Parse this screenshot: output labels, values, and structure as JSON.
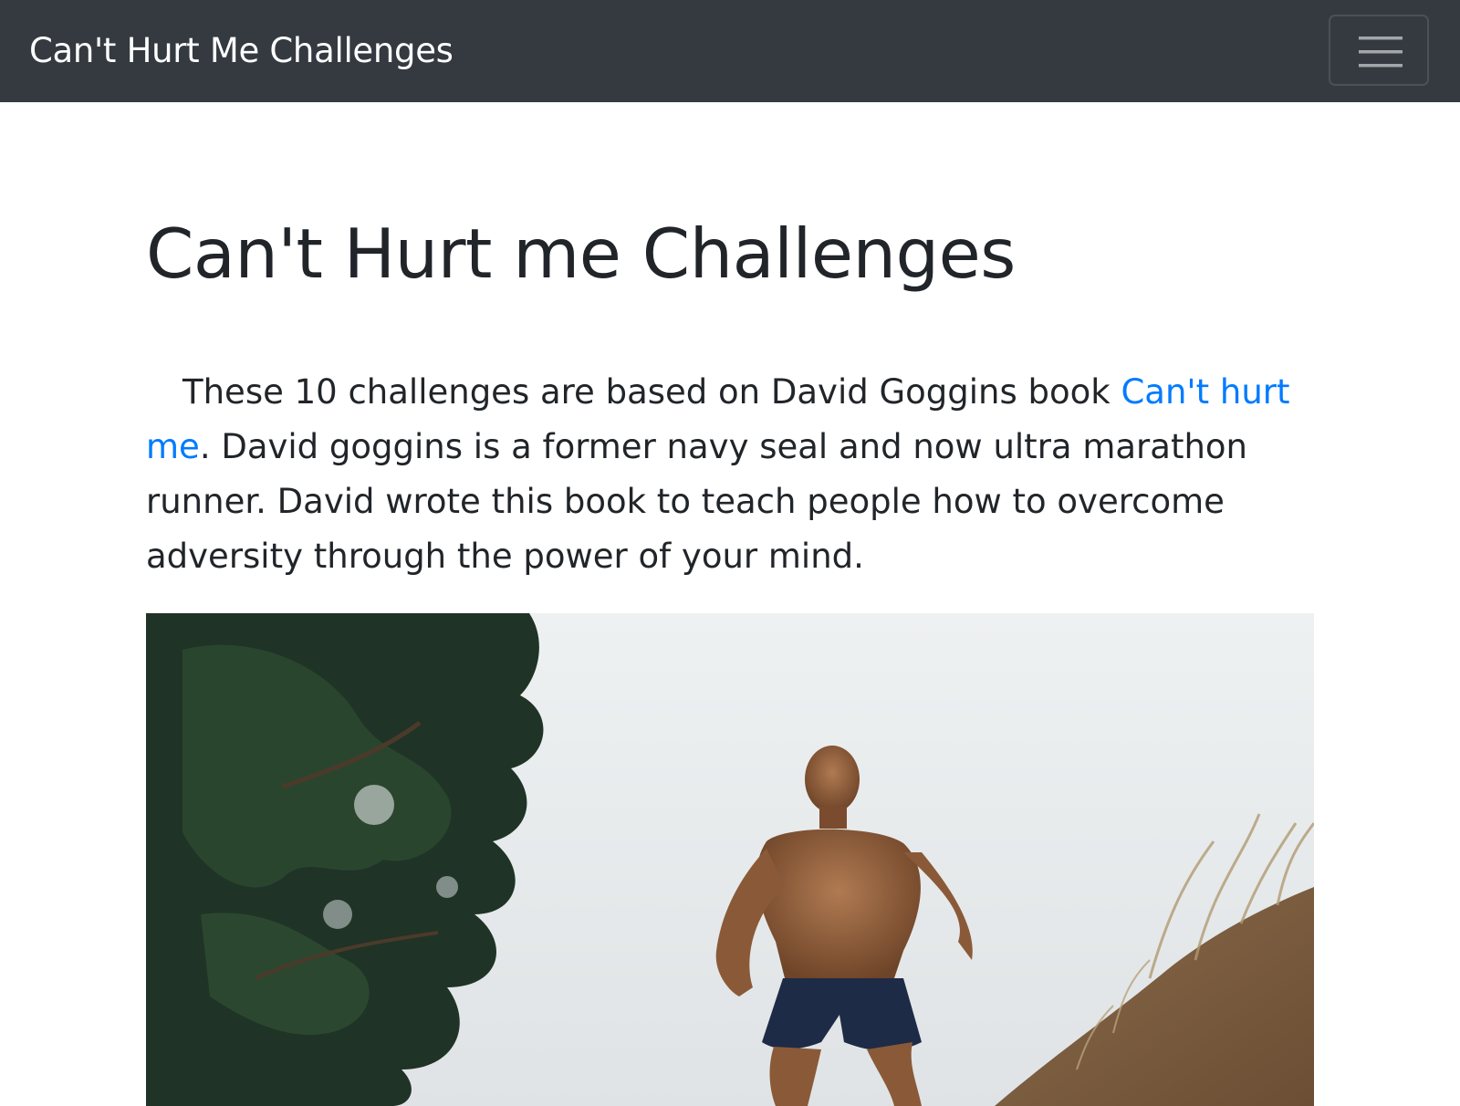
{
  "navbar": {
    "brand": "Can't Hurt Me Challenges",
    "toggle_icon": "menu-icon",
    "background": "#343a40"
  },
  "main": {
    "title": "Can't Hurt me Challenges",
    "intro": {
      "before_link": "These 10 challenges are based on David Goggins book ",
      "link_text": "Can't hurt me",
      "after_link": ". David goggins is a former navy seal and now ultra marathon runner. David wrote this book to teach people how to overcome adversity through the power of your mind."
    },
    "link_color": "#007bff"
  }
}
